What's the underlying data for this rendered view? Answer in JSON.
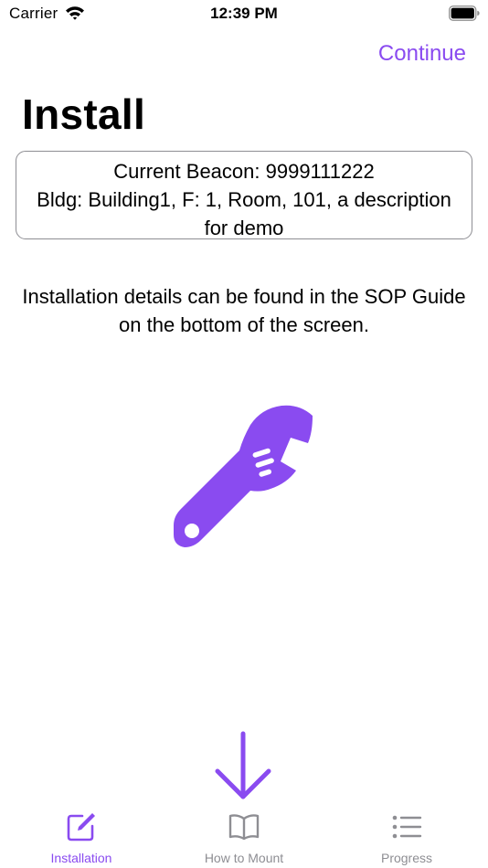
{
  "status_bar": {
    "carrier": "Carrier",
    "time": "12:39 PM"
  },
  "nav": {
    "continue_label": "Continue"
  },
  "page": {
    "title": "Install"
  },
  "beacon": {
    "current": "Current Beacon: 9999111222",
    "location": "Bldg: Building1, F: 1, Room, 101, a description for demo"
  },
  "instructions": "Installation details can be found in the SOP Guide on the bottom of the screen.",
  "tabs": [
    {
      "label": "Installation",
      "icon": "square-pencil-icon",
      "selected": true
    },
    {
      "label": "How to Mount",
      "icon": "book-icon",
      "selected": false
    },
    {
      "label": "Progress",
      "icon": "list-bullet-icon",
      "selected": false
    }
  ],
  "colors": {
    "accent": "#8a4bf0",
    "inactive": "#8e8e93",
    "border": "#8e8e93"
  }
}
